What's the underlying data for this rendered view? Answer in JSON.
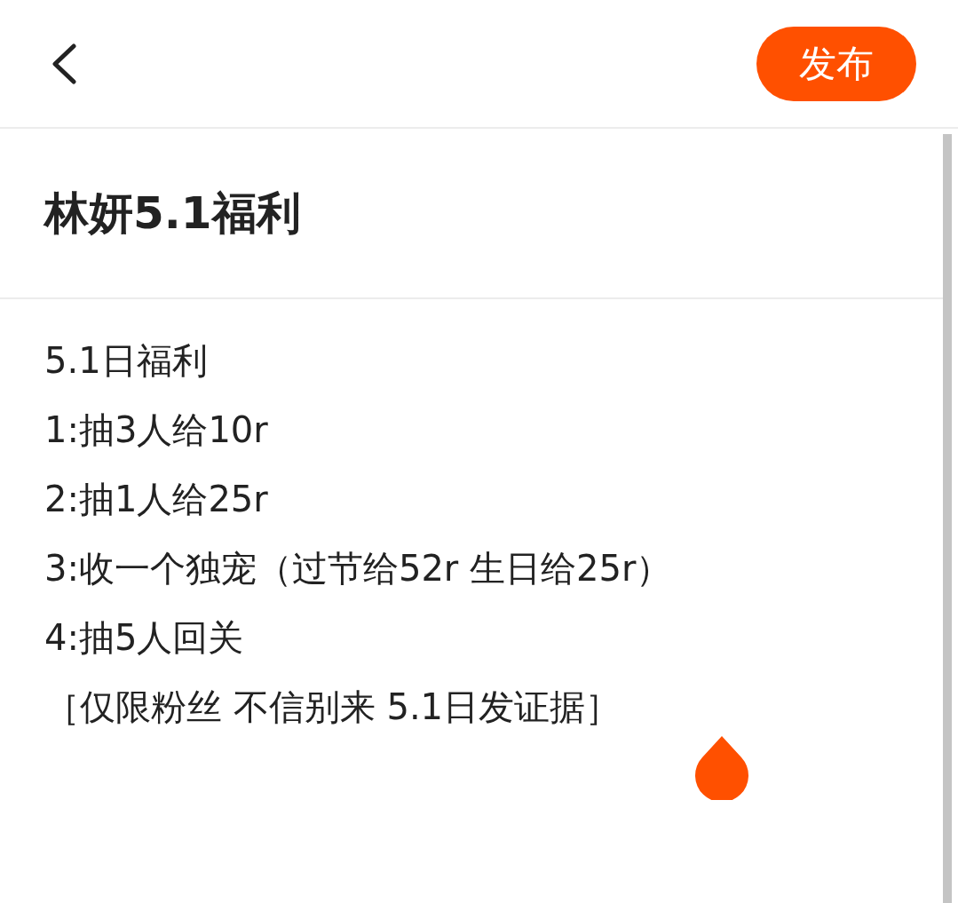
{
  "header": {
    "publish_button": "发布"
  },
  "title": "林妍5.1福利",
  "body": {
    "lines": [
      "5.1日福利",
      "1:抽3人给10r",
      "2:抽1人给25r",
      "3:收一个独宠（过节给52r 生日给25r）",
      "4:抽5人回关",
      "［仅限粉丝 不信别来 5.1日发证据］"
    ]
  }
}
